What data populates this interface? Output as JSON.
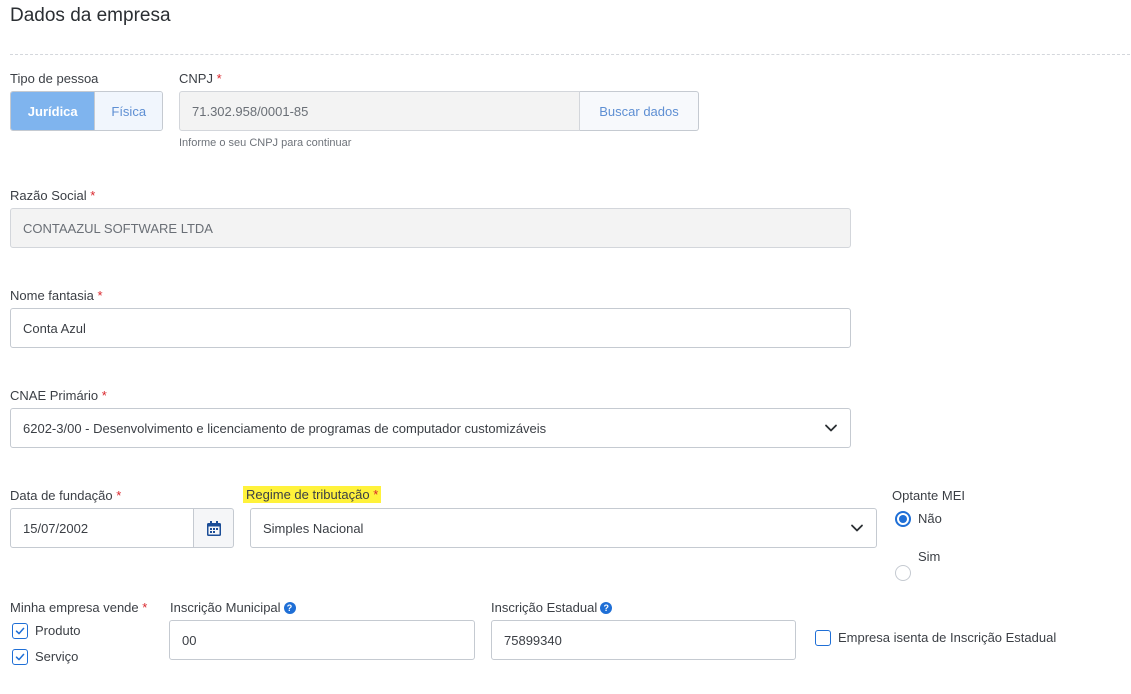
{
  "page": {
    "title": "Dados da empresa"
  },
  "tipo_pessoa": {
    "label": "Tipo de pessoa",
    "options": [
      "Jurídica",
      "Física"
    ],
    "selected": "Jurídica"
  },
  "cnpj": {
    "label": "CNPJ",
    "required_mark": "*",
    "value": "71.302.958/0001-85",
    "button": "Buscar dados",
    "hint": "Informe o seu CNPJ para continuar"
  },
  "razao_social": {
    "label": "Razão Social",
    "required_mark": "*",
    "value": "CONTAAZUL SOFTWARE LTDA"
  },
  "nome_fantasia": {
    "label": "Nome fantasia",
    "required_mark": "*",
    "value": "Conta Azul"
  },
  "cnae": {
    "label": "CNAE Primário",
    "required_mark": "*",
    "value": "6202-3/00 - Desenvolvimento e licenciamento de programas de computador customizáveis"
  },
  "data_fundacao": {
    "label": "Data de fundação",
    "required_mark": "*",
    "value": "15/07/2002",
    "icon": "calendar-icon"
  },
  "regime": {
    "label": "Regime de tributação",
    "required_mark": "*",
    "value": "Simples Nacional",
    "highlight_color": "#fff23b"
  },
  "optante_mei": {
    "label": "Optante MEI",
    "options": [
      "Não",
      "Sim"
    ],
    "selected": "Não"
  },
  "vende": {
    "label": "Minha empresa vende",
    "required_mark": "*",
    "options": [
      "Produto",
      "Serviço"
    ],
    "checked": [
      true,
      true
    ]
  },
  "inscricao_municipal": {
    "label": "Inscrição Municipal",
    "value": "00",
    "icon": "help-icon"
  },
  "inscricao_estadual": {
    "label": "Inscrição Estadual",
    "value": "75899340",
    "icon": "help-icon"
  },
  "isenta": {
    "label": "Empresa isenta de Inscrição Estadual",
    "checked": false
  },
  "colors": {
    "accent": "#1f6fd6",
    "required": "#d9262c",
    "segment_active": "#7fb4ee"
  }
}
